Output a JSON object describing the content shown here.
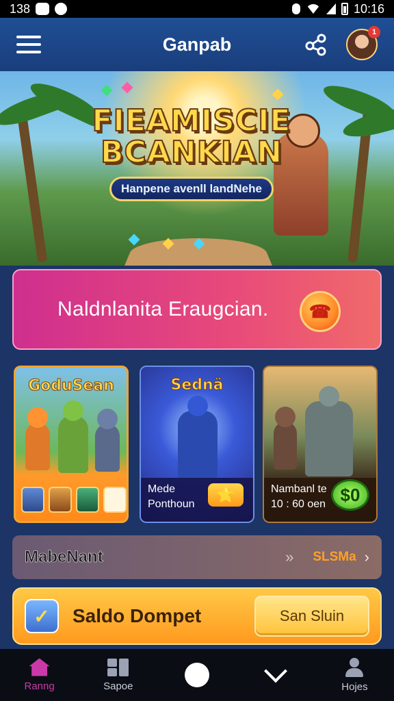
{
  "status_bar": {
    "left_text": "138",
    "time": "10:16"
  },
  "app_bar": {
    "title": "Ganpab",
    "notification_count": "1"
  },
  "hero": {
    "title_line1": "FIEAMISCIE",
    "title_line2": "BCANKIAN",
    "subtitle": "Hanpene avenll landNehe"
  },
  "promo": {
    "text": "Naldnlanita Eraugcian."
  },
  "game_cards": [
    {
      "title": "GoduSean",
      "caption_lines": []
    },
    {
      "title": "Sednä",
      "caption_lines": [
        "Mede",
        "Ponthoun"
      ],
      "badge": "⭐"
    },
    {
      "title": "",
      "caption_lines": [
        "Nambanl te",
        "10 : 60 oen"
      ],
      "badge": "$0"
    }
  ],
  "info_row": {
    "label": "MabeNant",
    "value": "SLSMa"
  },
  "wallet": {
    "label": "Saldo Dompet",
    "button_label": "San Sluin"
  },
  "bottom_nav": [
    {
      "label": "Ranng",
      "icon": "home-icon",
      "active": true
    },
    {
      "label": "Sapoe",
      "icon": "games-icon",
      "active": false
    },
    {
      "label": "",
      "icon": "circle-icon",
      "active": false
    },
    {
      "label": "",
      "icon": "chevron-down-icon",
      "active": false
    },
    {
      "label": "Hojes",
      "icon": "user-icon",
      "active": false
    }
  ],
  "colors": {
    "app_bar": "#1f4f94",
    "promo_gradient_start": "#cf2f8e",
    "wallet": "#ffb030",
    "nav_active": "#c93aa8"
  }
}
